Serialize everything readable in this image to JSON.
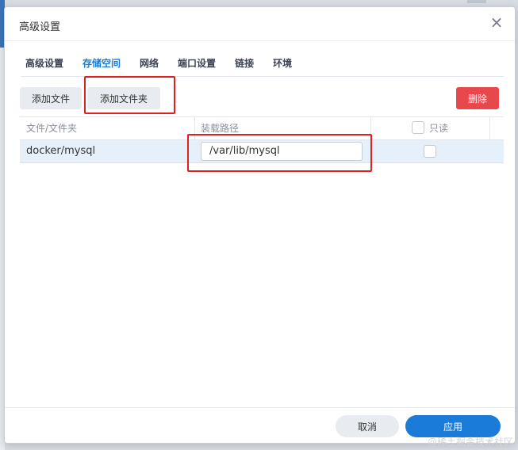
{
  "dialog": {
    "title": "高级设置",
    "close_icon": "close-icon"
  },
  "tabs": [
    {
      "label": "高级设置",
      "active": false
    },
    {
      "label": "存储空间",
      "active": true
    },
    {
      "label": "网络",
      "active": false
    },
    {
      "label": "端口设置",
      "active": false
    },
    {
      "label": "链接",
      "active": false
    },
    {
      "label": "环境",
      "active": false
    }
  ],
  "toolbar": {
    "add_file_label": "添加文件",
    "add_folder_label": "添加文件夹",
    "delete_label": "删除"
  },
  "table": {
    "headers": {
      "source": "文件/文件夹",
      "mount_path": "装载路径",
      "readonly": "只读"
    },
    "rows": [
      {
        "source": "docker/mysql",
        "mount_path": "/var/lib/mysql",
        "readonly": false
      }
    ]
  },
  "footer": {
    "cancel_label": "取消",
    "apply_label": "应用"
  },
  "watermark": "@稀土掘金技术社区",
  "colors": {
    "accent": "#1a7bd8",
    "danger": "#e8474c",
    "annotation": "#e02020",
    "selected_row": "#e6f0fb"
  }
}
